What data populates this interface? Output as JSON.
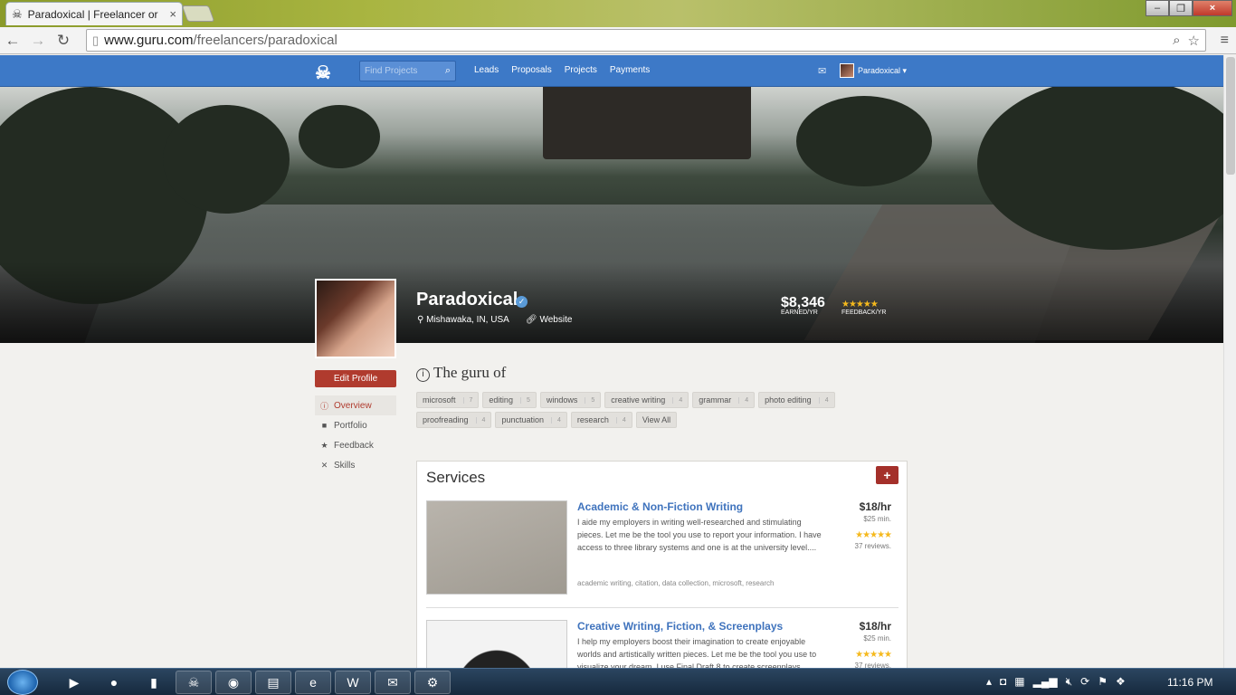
{
  "browser": {
    "tab_title": "Paradoxical | Freelancer or",
    "url_host": "www.guru.com",
    "url_path": "/freelancers/paradoxical"
  },
  "site_nav": {
    "search_placeholder": "Find Projects",
    "links": [
      "Leads",
      "Proposals",
      "Projects",
      "Payments"
    ],
    "user_name": "Paradoxical"
  },
  "profile": {
    "name": "Paradoxical",
    "location": "Mishawaka, IN, USA",
    "website_label": "Website",
    "earned_value": "$8,346",
    "earned_label": "EARNED/YR",
    "feedback_stars": "★★★★★",
    "feedback_label": "FEEDBACK/YR"
  },
  "sidebar": {
    "edit_button": "Edit Profile",
    "items": [
      {
        "label": "Overview",
        "icon": "info-icon"
      },
      {
        "label": "Portfolio",
        "icon": "briefcase-icon"
      },
      {
        "label": "Feedback",
        "icon": "star-icon"
      },
      {
        "label": "Skills",
        "icon": "tools-icon"
      }
    ]
  },
  "guru_of": {
    "title": "The guru of",
    "tags": [
      {
        "label": "microsoft",
        "count": "7"
      },
      {
        "label": "editing",
        "count": "5"
      },
      {
        "label": "windows",
        "count": "5"
      },
      {
        "label": "creative writing",
        "count": "4"
      },
      {
        "label": "grammar",
        "count": "4"
      },
      {
        "label": "photo editing",
        "count": "4"
      },
      {
        "label": "proofreading",
        "count": "4"
      },
      {
        "label": "punctuation",
        "count": "4"
      },
      {
        "label": "research",
        "count": "4"
      }
    ],
    "view_all": "View All"
  },
  "services": {
    "title": "Services",
    "add_label": "+",
    "items": [
      {
        "title": "Academic & Non-Fiction Writing",
        "description": "I aide my employers in writing well-researched and stimulating pieces. Let me be the tool you use to report your information. I have access to three library systems and one is at the university level....",
        "tags": "academic writing,  citation,  data collection,  microsoft,  research",
        "rate": "$18/hr",
        "min": "$25 min.",
        "stars": "★★★★★",
        "reviews": "37 reviews."
      },
      {
        "title": "Creative Writing, Fiction, & Screenplays",
        "description": "I help my employers boost their imagination to create enjoyable worlds and artistically written pieces. Let me be the tool you use to visualize your dream. I use Final Draft 8 to create screenplays.",
        "tags": "",
        "rate": "$18/hr",
        "min": "$25 min.",
        "stars": "★★★★★",
        "reviews": "37 reviews."
      }
    ]
  },
  "taskbar": {
    "clock": "11:16 PM"
  },
  "colors": {
    "nav_blue": "#3d79c7",
    "accent_red": "#b03b2e",
    "link_blue": "#3f73bd",
    "star_gold": "#f5b91d"
  }
}
